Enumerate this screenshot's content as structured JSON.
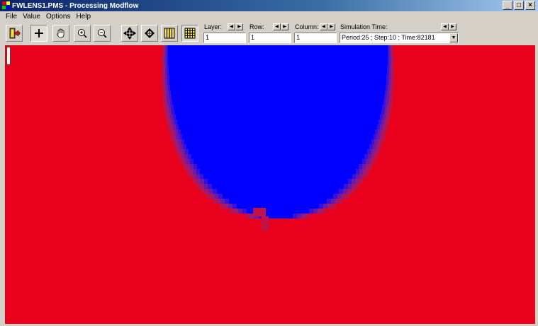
{
  "window": {
    "title": "FWLENS1.PMS - Processing Modflow",
    "buttons": [
      "_",
      "□",
      "×"
    ]
  },
  "menu": [
    "File",
    "Value",
    "Options",
    "Help"
  ],
  "toolbar": {
    "buttons": [
      {
        "name": "exit-icon"
      },
      {
        "name": "crosshair-icon"
      },
      {
        "name": "pan-hand-icon"
      },
      {
        "name": "zoom-in-icon"
      },
      {
        "name": "zoom-out-icon"
      },
      {
        "name": "move-arrows-icon"
      },
      {
        "name": "diamond-icon"
      },
      {
        "name": "grid-columns-icon"
      },
      {
        "name": "grid-cells-icon"
      }
    ],
    "layer": {
      "label": "Layer:",
      "value": "1"
    },
    "row": {
      "label": "Row:",
      "value": "1"
    },
    "column": {
      "label": "Column:",
      "value": "1"
    },
    "simulation_time": {
      "label": "Simulation Time:",
      "value": "Period:25 ; Step:10 ; Time:82181"
    }
  },
  "colors": {
    "background": "#e8001c",
    "plume": "#0000ff",
    "transition_1": "#3a10d8",
    "transition_2": "#6a1aa8",
    "transition_3": "#9a1a78",
    "transition_4": "#c01248"
  }
}
